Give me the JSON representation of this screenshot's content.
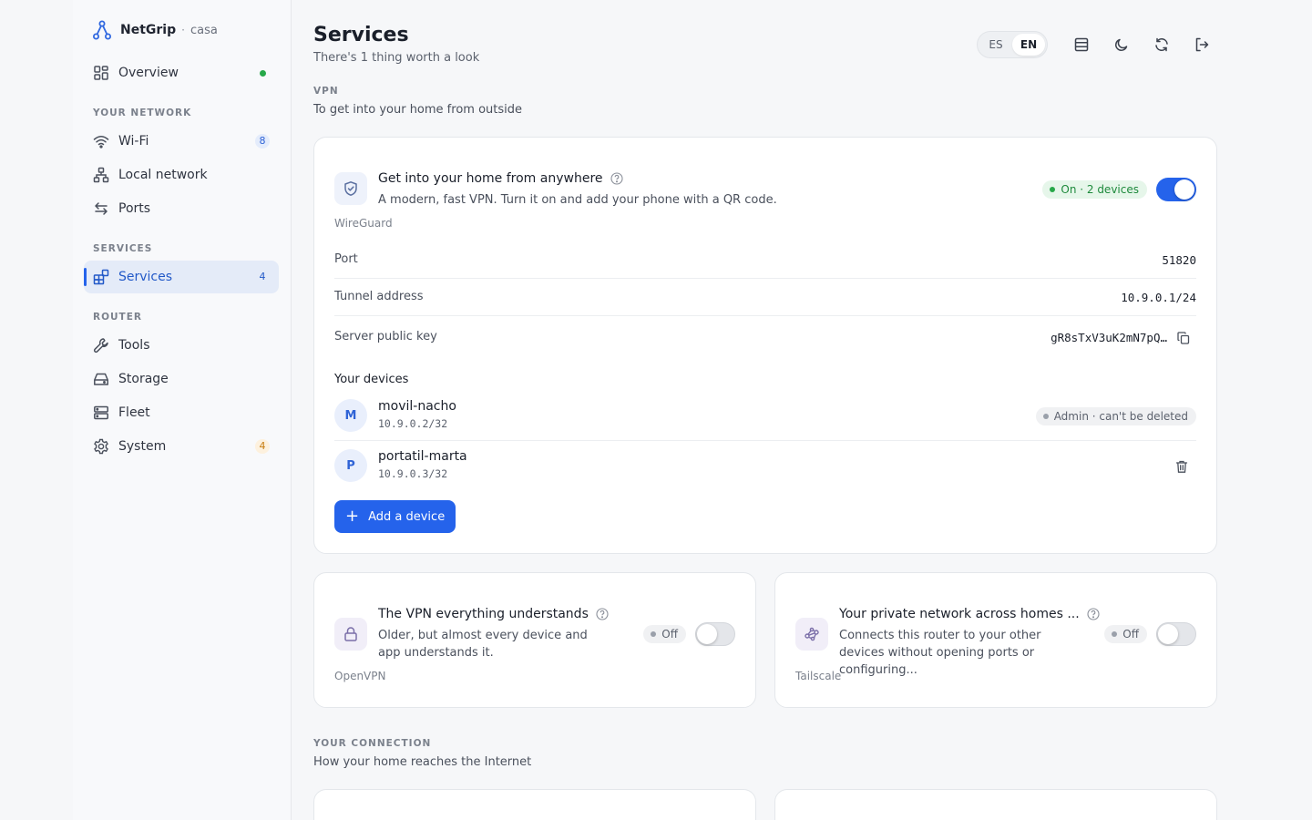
{
  "brand": {
    "name": "NetGrip",
    "separator": "·",
    "host": "casa"
  },
  "sidebar": {
    "overview": {
      "label": "Overview",
      "status": "online"
    },
    "sections": [
      {
        "title": "YOUR NETWORK"
      },
      {
        "title": "SERVICES"
      },
      {
        "title": "ROUTER"
      }
    ],
    "items": [
      {
        "label": "Wi-Fi",
        "badge": "8",
        "icon": "wifi-icon"
      },
      {
        "label": "Local network",
        "badge": "",
        "icon": "network-icon"
      },
      {
        "label": "Ports",
        "badge": "",
        "icon": "ports-icon"
      },
      {
        "label": "Services",
        "badge": "4",
        "icon": "services-icon",
        "active": true
      },
      {
        "label": "Tools",
        "badge": "",
        "icon": "wrench-icon"
      },
      {
        "label": "Storage",
        "badge": "",
        "icon": "storage-icon"
      },
      {
        "label": "Fleet",
        "badge": "",
        "icon": "fleet-icon"
      },
      {
        "label": "System",
        "badge": "4",
        "icon": "gear-icon"
      }
    ]
  },
  "header": {
    "title": "Services",
    "subtitle": "There's 1 thing worth a look",
    "languages": [
      "ES",
      "EN"
    ],
    "active_language": "EN"
  },
  "vpn_section": {
    "label": "VPN",
    "description": "To get into your home from outside"
  },
  "wireguard": {
    "title": "Get into your home from anywhere",
    "description": "A modern, fast VPN. Turn it on and add your phone with a QR code.",
    "tech": "WireGuard",
    "status": "On · 2 devices",
    "enabled": true,
    "fields": [
      {
        "label": "Port",
        "value": "51820"
      },
      {
        "label": "Tunnel address",
        "value": "10.9.0.1/24"
      },
      {
        "label": "Server public key",
        "value": "gR8sTxV3uK2mN7pQ…"
      }
    ],
    "devices_title": "Your devices",
    "devices": [
      {
        "initial": "M",
        "name": "movil-nacho",
        "ip": "10.9.0.2/32",
        "tag": "Admin · can't be deleted"
      },
      {
        "initial": "P",
        "name": "portatil-marta",
        "ip": "10.9.0.3/32",
        "tag": ""
      }
    ],
    "add_label": "Add a device"
  },
  "openvpn": {
    "title": "The VPN everything understands",
    "description": "Older, but almost every device and app understands it.",
    "tech": "OpenVPN",
    "status": "Off",
    "enabled": false
  },
  "tailscale": {
    "title": "Your private network across homes ...",
    "description": "Connects this router to your other devices without opening ports or configuring...",
    "tech": "Tailscale",
    "status": "Off",
    "enabled": false
  },
  "connection_section": {
    "label": "YOUR CONNECTION",
    "description": "How your home reaches the Internet"
  },
  "colors": {
    "accent": "#2563eb",
    "success": "#27a849",
    "warning": "#c77c10"
  }
}
